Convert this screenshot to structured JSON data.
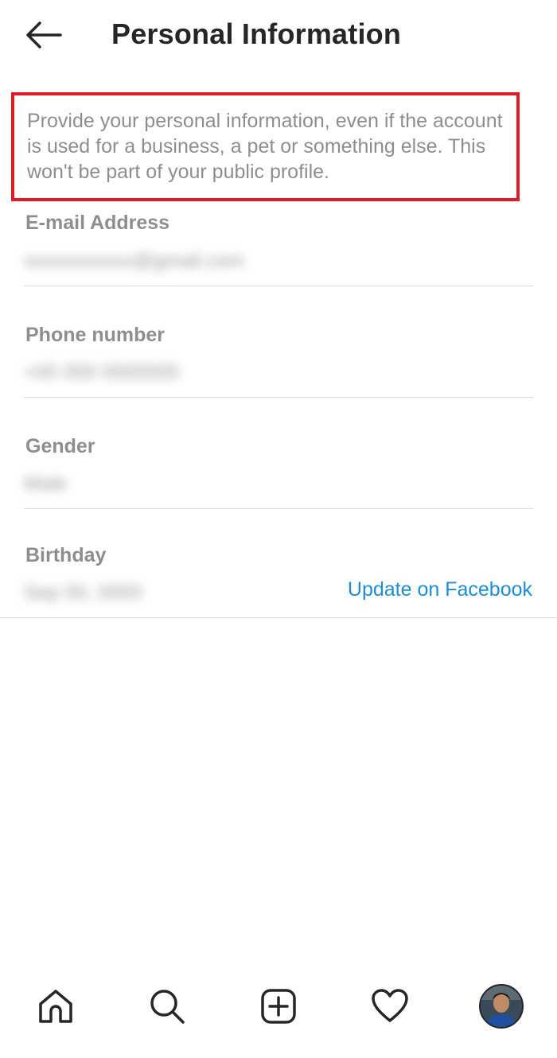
{
  "header": {
    "title": "Personal Information",
    "back_icon": "arrow-left-icon"
  },
  "notice": {
    "text": "Provide your personal information, even if the account is used for a business, a pet or something else. This won't be part of your public profile.",
    "highlight_color": "#e01b24"
  },
  "fields": [
    {
      "label": "E-mail Address",
      "value": "xxxxxxxxxxx@gmail.com"
    },
    {
      "label": "Phone number",
      "value": "+00 000 0000000"
    },
    {
      "label": "Gender",
      "value": "Male"
    },
    {
      "label": "Birthday",
      "value": "Sep 00, 0000"
    }
  ],
  "birthday_action": {
    "label": "Update on Facebook",
    "color": "#1a8ed8"
  },
  "tabbar": {
    "items": [
      {
        "name": "home",
        "icon": "home-icon"
      },
      {
        "name": "search",
        "icon": "search-icon"
      },
      {
        "name": "create",
        "icon": "plus-square-icon"
      },
      {
        "name": "activity",
        "icon": "heart-icon"
      },
      {
        "name": "profile",
        "icon": "avatar"
      }
    ]
  }
}
